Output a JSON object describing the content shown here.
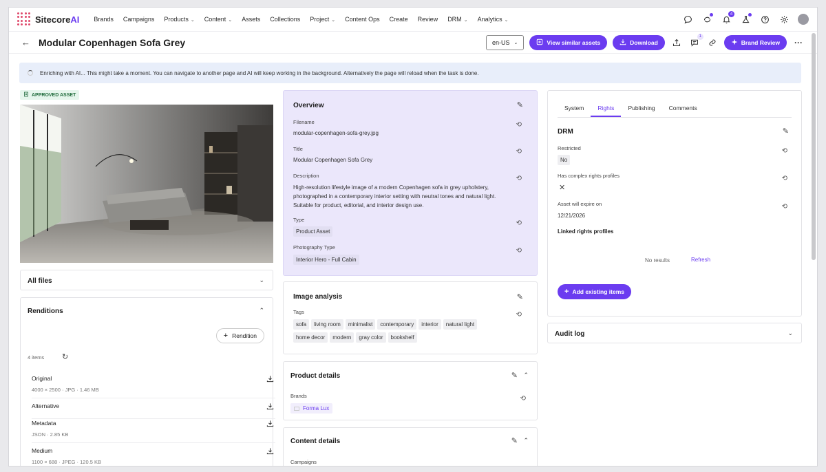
{
  "app": {
    "logo_text": "Sitecore",
    "logo_suffix": "AI"
  },
  "nav": {
    "items": [
      {
        "label": "Brands",
        "chevron": false
      },
      {
        "label": "Campaigns",
        "chevron": false
      },
      {
        "label": "Products",
        "chevron": true
      },
      {
        "label": "Content",
        "chevron": true
      },
      {
        "label": "Assets",
        "chevron": false
      },
      {
        "label": "Collections",
        "chevron": false
      },
      {
        "label": "Project",
        "chevron": true
      },
      {
        "label": "Content Ops",
        "chevron": false
      },
      {
        "label": "Create",
        "chevron": false
      },
      {
        "label": "Review",
        "chevron": false
      },
      {
        "label": "DRM",
        "chevron": true
      },
      {
        "label": "Analytics",
        "chevron": true
      }
    ],
    "notification_count": "4"
  },
  "header": {
    "title": "Modular Copenhagen Sofa Grey",
    "locale": "en-US",
    "view_similar": "View similar assets",
    "download": "Download",
    "comments_count": "1",
    "brand_review": "Brand Review"
  },
  "banner": {
    "text": "Enriching with AI... This might take a moment. You can navigate to another page and AI will keep working in the background. Alternatively the page will reload when the task is done."
  },
  "left": {
    "approved_label": "APPROVED ASSET",
    "all_files": "All files",
    "renditions_title": "Renditions",
    "rendition_button": "Rendition",
    "items_count": "4 items",
    "renditions": [
      {
        "name": "Original",
        "meta": "4000 × 2500 · JPG · 1.46 MB"
      },
      {
        "name": "Alternative",
        "meta": ""
      },
      {
        "name": "Metadata",
        "meta": "JSON · 2.85 KB"
      },
      {
        "name": "Medium",
        "meta": "1100 × 688 · JPEG · 120.5 KB"
      }
    ]
  },
  "overview": {
    "title": "Overview",
    "filename_label": "Filename",
    "filename": "modular-copenhagen-sofa-grey.jpg",
    "title_label": "Title",
    "title_value": "Modular Copenhagen Sofa Grey",
    "description_label": "Description",
    "description": "High-resolution lifestyle image of a modern Copenhagen sofa in grey upholstery, photographed in a contemporary interior setting with neutral tones and natural light. Suitable for product, editorial, and interior design use.",
    "type_label": "Type",
    "type_value": "Product Asset",
    "photo_type_label": "Photography Type",
    "photo_type_value": "Interior Hero - Full Cabin"
  },
  "image_analysis": {
    "title": "Image analysis",
    "tags_label": "Tags",
    "tags": [
      "sofa",
      "living room",
      "minimalist",
      "contemporary",
      "interior",
      "natural light",
      "home decor",
      "modern",
      "gray color",
      "bookshelf"
    ]
  },
  "product_details": {
    "title": "Product details",
    "brands_label": "Brands",
    "brand": "Forma Lux"
  },
  "content_details": {
    "title": "Content details",
    "campaigns_label": "Campaigns"
  },
  "rights": {
    "tabs": [
      "System",
      "Rights",
      "Publishing",
      "Comments"
    ],
    "active_tab": "Rights",
    "drm_title": "DRM",
    "restricted_label": "Restricted",
    "restricted_value": "No",
    "complex_label": "Has complex rights profiles",
    "complex_value": "✕",
    "expire_label": "Asset will expire on",
    "expire_value": "12/21/2026",
    "linked_label": "Linked rights profiles",
    "no_results": "No results",
    "refresh": "Refresh",
    "add_existing": "Add existing items"
  },
  "audit": {
    "title": "Audit log"
  }
}
